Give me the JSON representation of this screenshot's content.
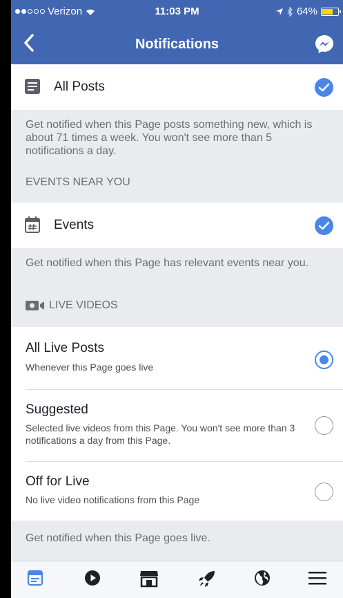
{
  "status": {
    "carrier": "Verizon",
    "time": "11:03 PM",
    "battery": "64%",
    "battery_level": 0.64,
    "signal_bars_filled": 2,
    "signal_bars_total": 5
  },
  "nav": {
    "title": "Notifications",
    "back_icon": "chevron-left-icon",
    "right_icon": "messenger-icon"
  },
  "all_posts": {
    "label": "All Posts",
    "checked": true,
    "description": "Get notified when this Page posts something new, which is about 71 times a week. You won't see more than 5 notifications a day."
  },
  "events": {
    "section": "EVENTS NEAR YOU",
    "label": "Events",
    "checked": true,
    "description": "Get notified when this Page has relevant events near you."
  },
  "live": {
    "section": "LIVE VIDEOS",
    "options": [
      {
        "title": "All Live Posts",
        "subtitle": "Whenever this Page goes live",
        "selected": true
      },
      {
        "title": "Suggested",
        "subtitle": "Selected live videos from this Page. You won't see more than 3 notifications a day from this Page.",
        "selected": false
      },
      {
        "title": "Off for Live",
        "subtitle": "No live video notifications from this Page",
        "selected": false
      }
    ],
    "footer": "Get notified when this Page goes live."
  },
  "colors": {
    "brand": "#4267b2",
    "accent": "#4a86e8",
    "background": "#e9ebee"
  },
  "tabbar": [
    "news-feed-icon",
    "video-icon",
    "marketplace-icon",
    "rocket-icon",
    "globe-icon",
    "menu-icon"
  ]
}
